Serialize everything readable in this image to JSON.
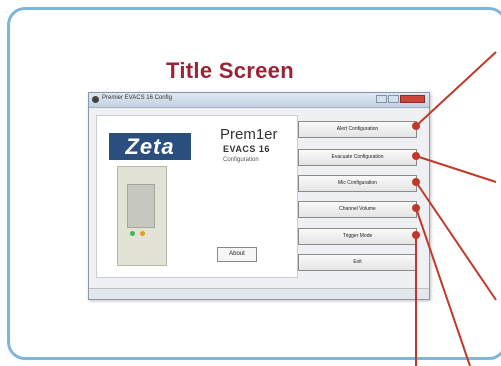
{
  "heading": "Title Screen",
  "window": {
    "title": "Premier EVACS 16 Config",
    "brand_logo_text": "Zeta",
    "product_name": "Prem1er",
    "product_model": "EVACS 16",
    "product_subtitle": "Configuration",
    "about_label": "About"
  },
  "buttons": [
    {
      "label": "Alert Configuration"
    },
    {
      "label": "Evacuate Configuration"
    },
    {
      "label": "Mic Configuration"
    },
    {
      "label": "Channel Volume"
    },
    {
      "label": "Trigger Mode"
    },
    {
      "label": "Exit"
    }
  ],
  "colors": {
    "frame": "#7eb6d9",
    "heading": "#9b2335",
    "callout": "#c0392b",
    "logo_bg": "#2a4f7f"
  }
}
